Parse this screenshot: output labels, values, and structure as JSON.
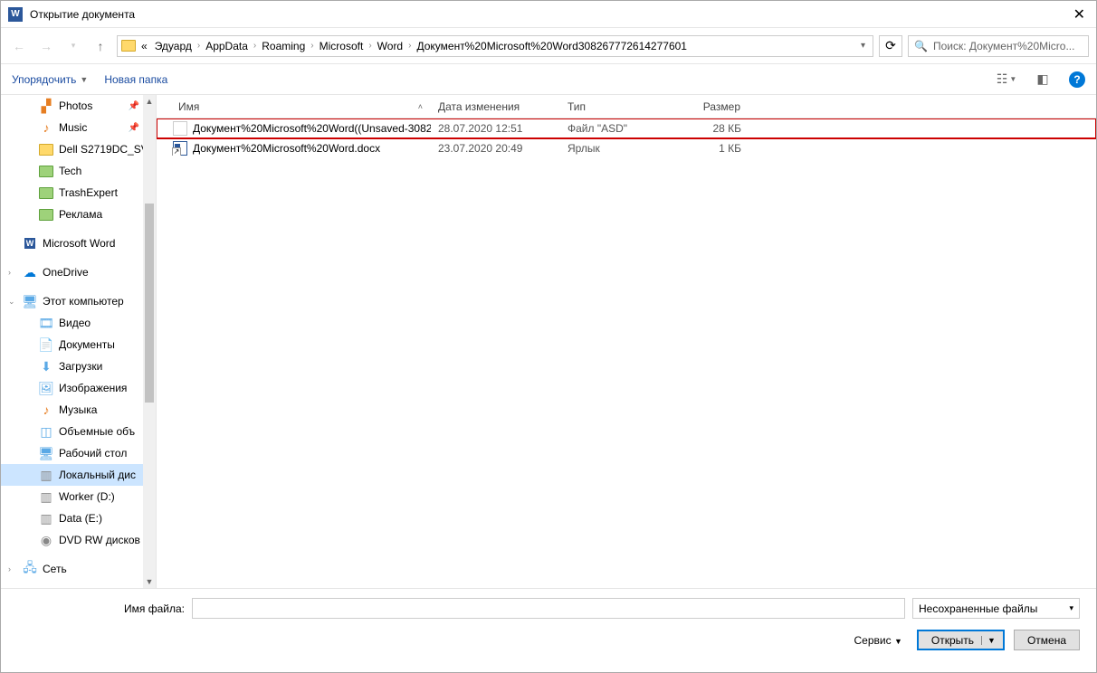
{
  "window": {
    "title": "Открытие документа",
    "app_icon_letter": "W"
  },
  "nav": {
    "crumb_prefix": "«",
    "crumbs": [
      "Эдуард",
      "AppData",
      "Roaming",
      "Microsoft",
      "Word",
      "Документ%20Microsoft%20Word308267772614277601"
    ],
    "search_placeholder": "Поиск: Документ%20Micro..."
  },
  "toolbar": {
    "organize": "Упорядочить",
    "new_folder": "Новая папка"
  },
  "sidebar": {
    "items": [
      {
        "label": "Photos",
        "icon": "photos",
        "pin": true
      },
      {
        "label": "Music",
        "icon": "music",
        "pin": true
      },
      {
        "label": "Dell S2719DC_SV",
        "icon": "folder"
      },
      {
        "label": "Tech",
        "icon": "folder-green"
      },
      {
        "label": "TrashExpert",
        "icon": "folder-green"
      },
      {
        "label": "Реклама",
        "icon": "folder-green"
      }
    ],
    "word": "Microsoft Word",
    "onedrive": "OneDrive",
    "thispc": "Этот компьютер",
    "pc_items": [
      {
        "label": "Видео",
        "icon": "video"
      },
      {
        "label": "Документы",
        "icon": "docs"
      },
      {
        "label": "Загрузки",
        "icon": "downloads"
      },
      {
        "label": "Изображения",
        "icon": "pictures"
      },
      {
        "label": "Музыка",
        "icon": "music"
      },
      {
        "label": "Объемные объ",
        "icon": "3d"
      },
      {
        "label": "Рабочий стол",
        "icon": "desktop"
      },
      {
        "label": "Локальный дис",
        "icon": "drive",
        "selected": true
      },
      {
        "label": "Worker (D:)",
        "icon": "drive"
      },
      {
        "label": "Data (E:)",
        "icon": "drive"
      },
      {
        "label": "DVD RW дисков",
        "icon": "dvd"
      }
    ],
    "network": "Сеть"
  },
  "columns": {
    "name": "Имя",
    "date": "Дата изменения",
    "type": "Тип",
    "size": "Размер"
  },
  "files": [
    {
      "name": "Документ%20Microsoft%20Word((Unsaved-3082...",
      "date": "28.07.2020 12:51",
      "type": "Файл \"ASD\"",
      "size": "28 КБ",
      "icon": "blank",
      "highlighted": true
    },
    {
      "name": "Документ%20Microsoft%20Word.docx",
      "date": "23.07.2020 20:49",
      "type": "Ярлык",
      "size": "1 КБ",
      "icon": "word-shortcut",
      "highlighted": false
    }
  ],
  "bottom": {
    "filename_label": "Имя файла:",
    "filename_value": "",
    "filter": "Несохраненные файлы",
    "tools": "Сервис",
    "open": "Открыть",
    "cancel": "Отмена"
  }
}
